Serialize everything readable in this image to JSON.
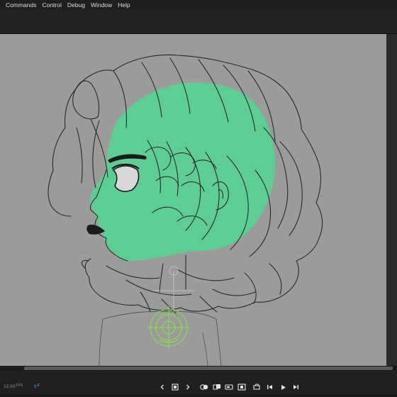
{
  "menu": {
    "items": [
      {
        "label": "Commands"
      },
      {
        "label": "Control"
      },
      {
        "label": "Debug"
      },
      {
        "label": "Window"
      },
      {
        "label": "Help"
      }
    ]
  },
  "timeline": {
    "fps_value": "12.00",
    "fps_unit": "FPS",
    "frame_value": "8",
    "frame_unit": "F"
  },
  "controls": {
    "icons": [
      "previous-keyframe-icon",
      "insert-keyframe-icon",
      "next-keyframe-icon",
      "onion-skin-icon",
      "edit-multiple-frames-icon",
      "loop-icon",
      "center-frame-icon",
      "camera-icon",
      "step-back-icon",
      "play-icon",
      "step-forward-icon"
    ]
  },
  "colors": {
    "stage": "#9b9b9b",
    "skin_fill": "#5ecd93",
    "line": "#2a2a2a",
    "rig_guide": "#8be04a",
    "frame_accent": "#2f8fe6"
  }
}
